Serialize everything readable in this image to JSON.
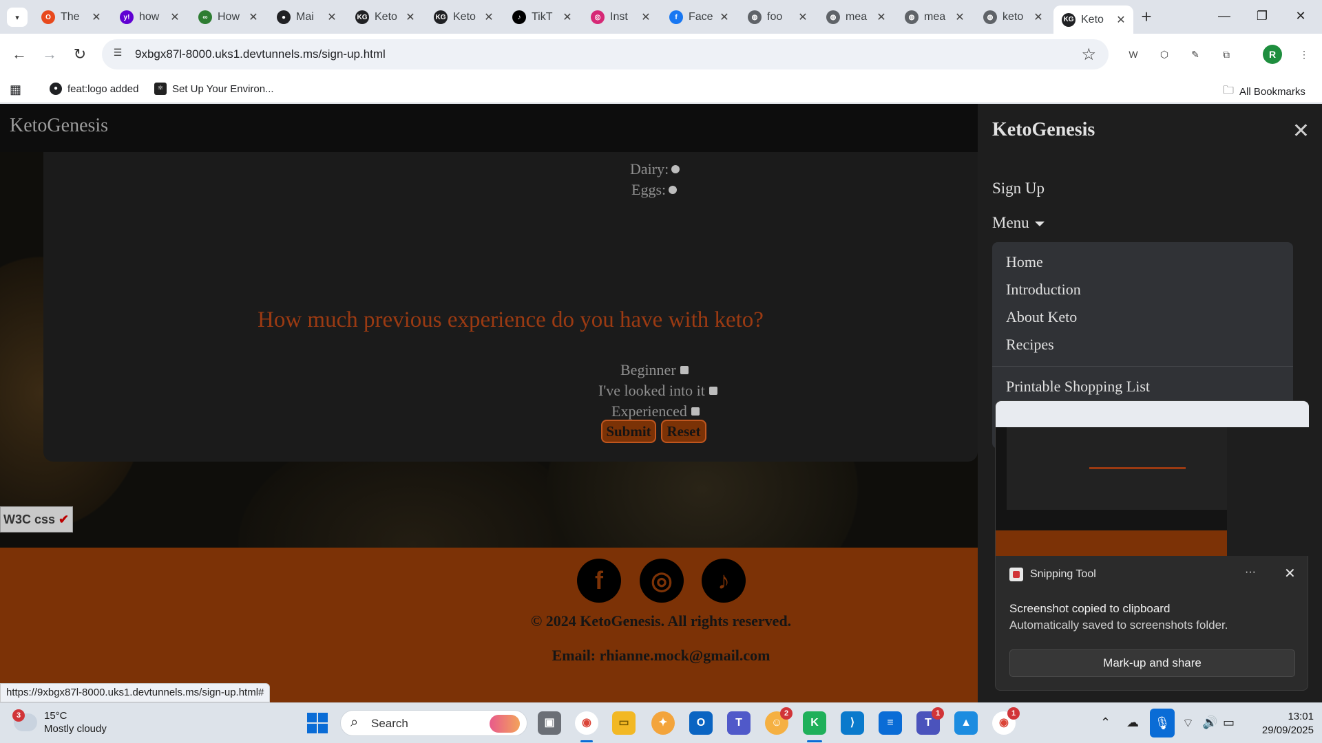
{
  "browser": {
    "tabs": [
      {
        "label": "The",
        "icon": "opera-icon",
        "color": "#e8491d"
      },
      {
        "label": "how",
        "icon": "yahoo-icon",
        "color": "#6001d2"
      },
      {
        "label": "How",
        "icon": "glasses-icon",
        "color": "#2e7d32"
      },
      {
        "label": "Mai",
        "icon": "github-icon",
        "color": "#202124"
      },
      {
        "label": "Keto",
        "icon": "kg-icon",
        "color": "#202124"
      },
      {
        "label": "Keto",
        "icon": "kg-icon",
        "color": "#202124"
      },
      {
        "label": "TikT",
        "icon": "tiktok-icon",
        "color": "#000000"
      },
      {
        "label": "Inst",
        "icon": "instagram-icon",
        "color": "#d62976"
      },
      {
        "label": "Face",
        "icon": "facebook-icon",
        "color": "#1877f2"
      },
      {
        "label": "foo",
        "icon": "globe-icon",
        "color": "#5f6368"
      },
      {
        "label": "mea",
        "icon": "globe-icon",
        "color": "#5f6368"
      },
      {
        "label": "mea",
        "icon": "globe-icon",
        "color": "#5f6368"
      },
      {
        "label": "keto",
        "icon": "globe-icon",
        "color": "#5f6368"
      },
      {
        "label": "Keto",
        "icon": "kg-icon",
        "color": "#202124",
        "active": true
      }
    ],
    "url": "9xbgx87l-8000.uks1.devtunnels.ms/sign-up.html",
    "profile_initial": "R",
    "bookmarks": [
      {
        "label": "feat:logo added",
        "icon": "github-icon"
      },
      {
        "label": "Set Up Your Environ...",
        "icon": "react-icon"
      }
    ],
    "all_bookmarks_label": "All Bookmarks",
    "status_url": "https://9xbgx87l-8000.uks1.devtunnels.ms/sign-up.html#"
  },
  "site": {
    "brand": "KetoGenesis",
    "allergies": [
      {
        "label": "Dairy:"
      },
      {
        "label": "Eggs:"
      }
    ],
    "question": "How much previous experience do you have with keto?",
    "experience_options": [
      {
        "label": "Beginner"
      },
      {
        "label": "I've looked into it"
      },
      {
        "label": "Experienced"
      }
    ],
    "submit_label": "Submit",
    "reset_label": "Reset",
    "w3c_badge": "W3C css",
    "footer": {
      "copyright": "© 2024 KetoGenesis. All rights reserved.",
      "email": "Email: rhianne.mock@gmail.com",
      "social": [
        {
          "name": "facebook-icon",
          "glyph": "f"
        },
        {
          "name": "instagram-icon",
          "glyph": "◎"
        },
        {
          "name": "tiktok-icon",
          "glyph": "♪"
        }
      ]
    },
    "offcanvas": {
      "title": "KetoGenesis",
      "signup": "Sign Up",
      "menu": "Menu",
      "items": [
        "Home",
        "Introduction",
        "About Keto",
        "Recipes"
      ],
      "extra_item": "Printable Shopping List"
    }
  },
  "toast": {
    "app": "Snipping Tool",
    "heading": "Screenshot copied to clipboard",
    "body": "Automatically saved to screenshots folder.",
    "button": "Mark-up and share"
  },
  "taskbar": {
    "weather_temp": "15°C",
    "weather_desc": "Mostly cloudy",
    "weather_badge": "3",
    "search_label": "Search",
    "time": "13:01",
    "date": "29/09/2025",
    "badges": {
      "teams_like": "2",
      "teams": "1",
      "chrome_other": "1"
    }
  },
  "colors": {
    "accent_orange": "#7c3206",
    "question_color": "#9b3a12"
  }
}
